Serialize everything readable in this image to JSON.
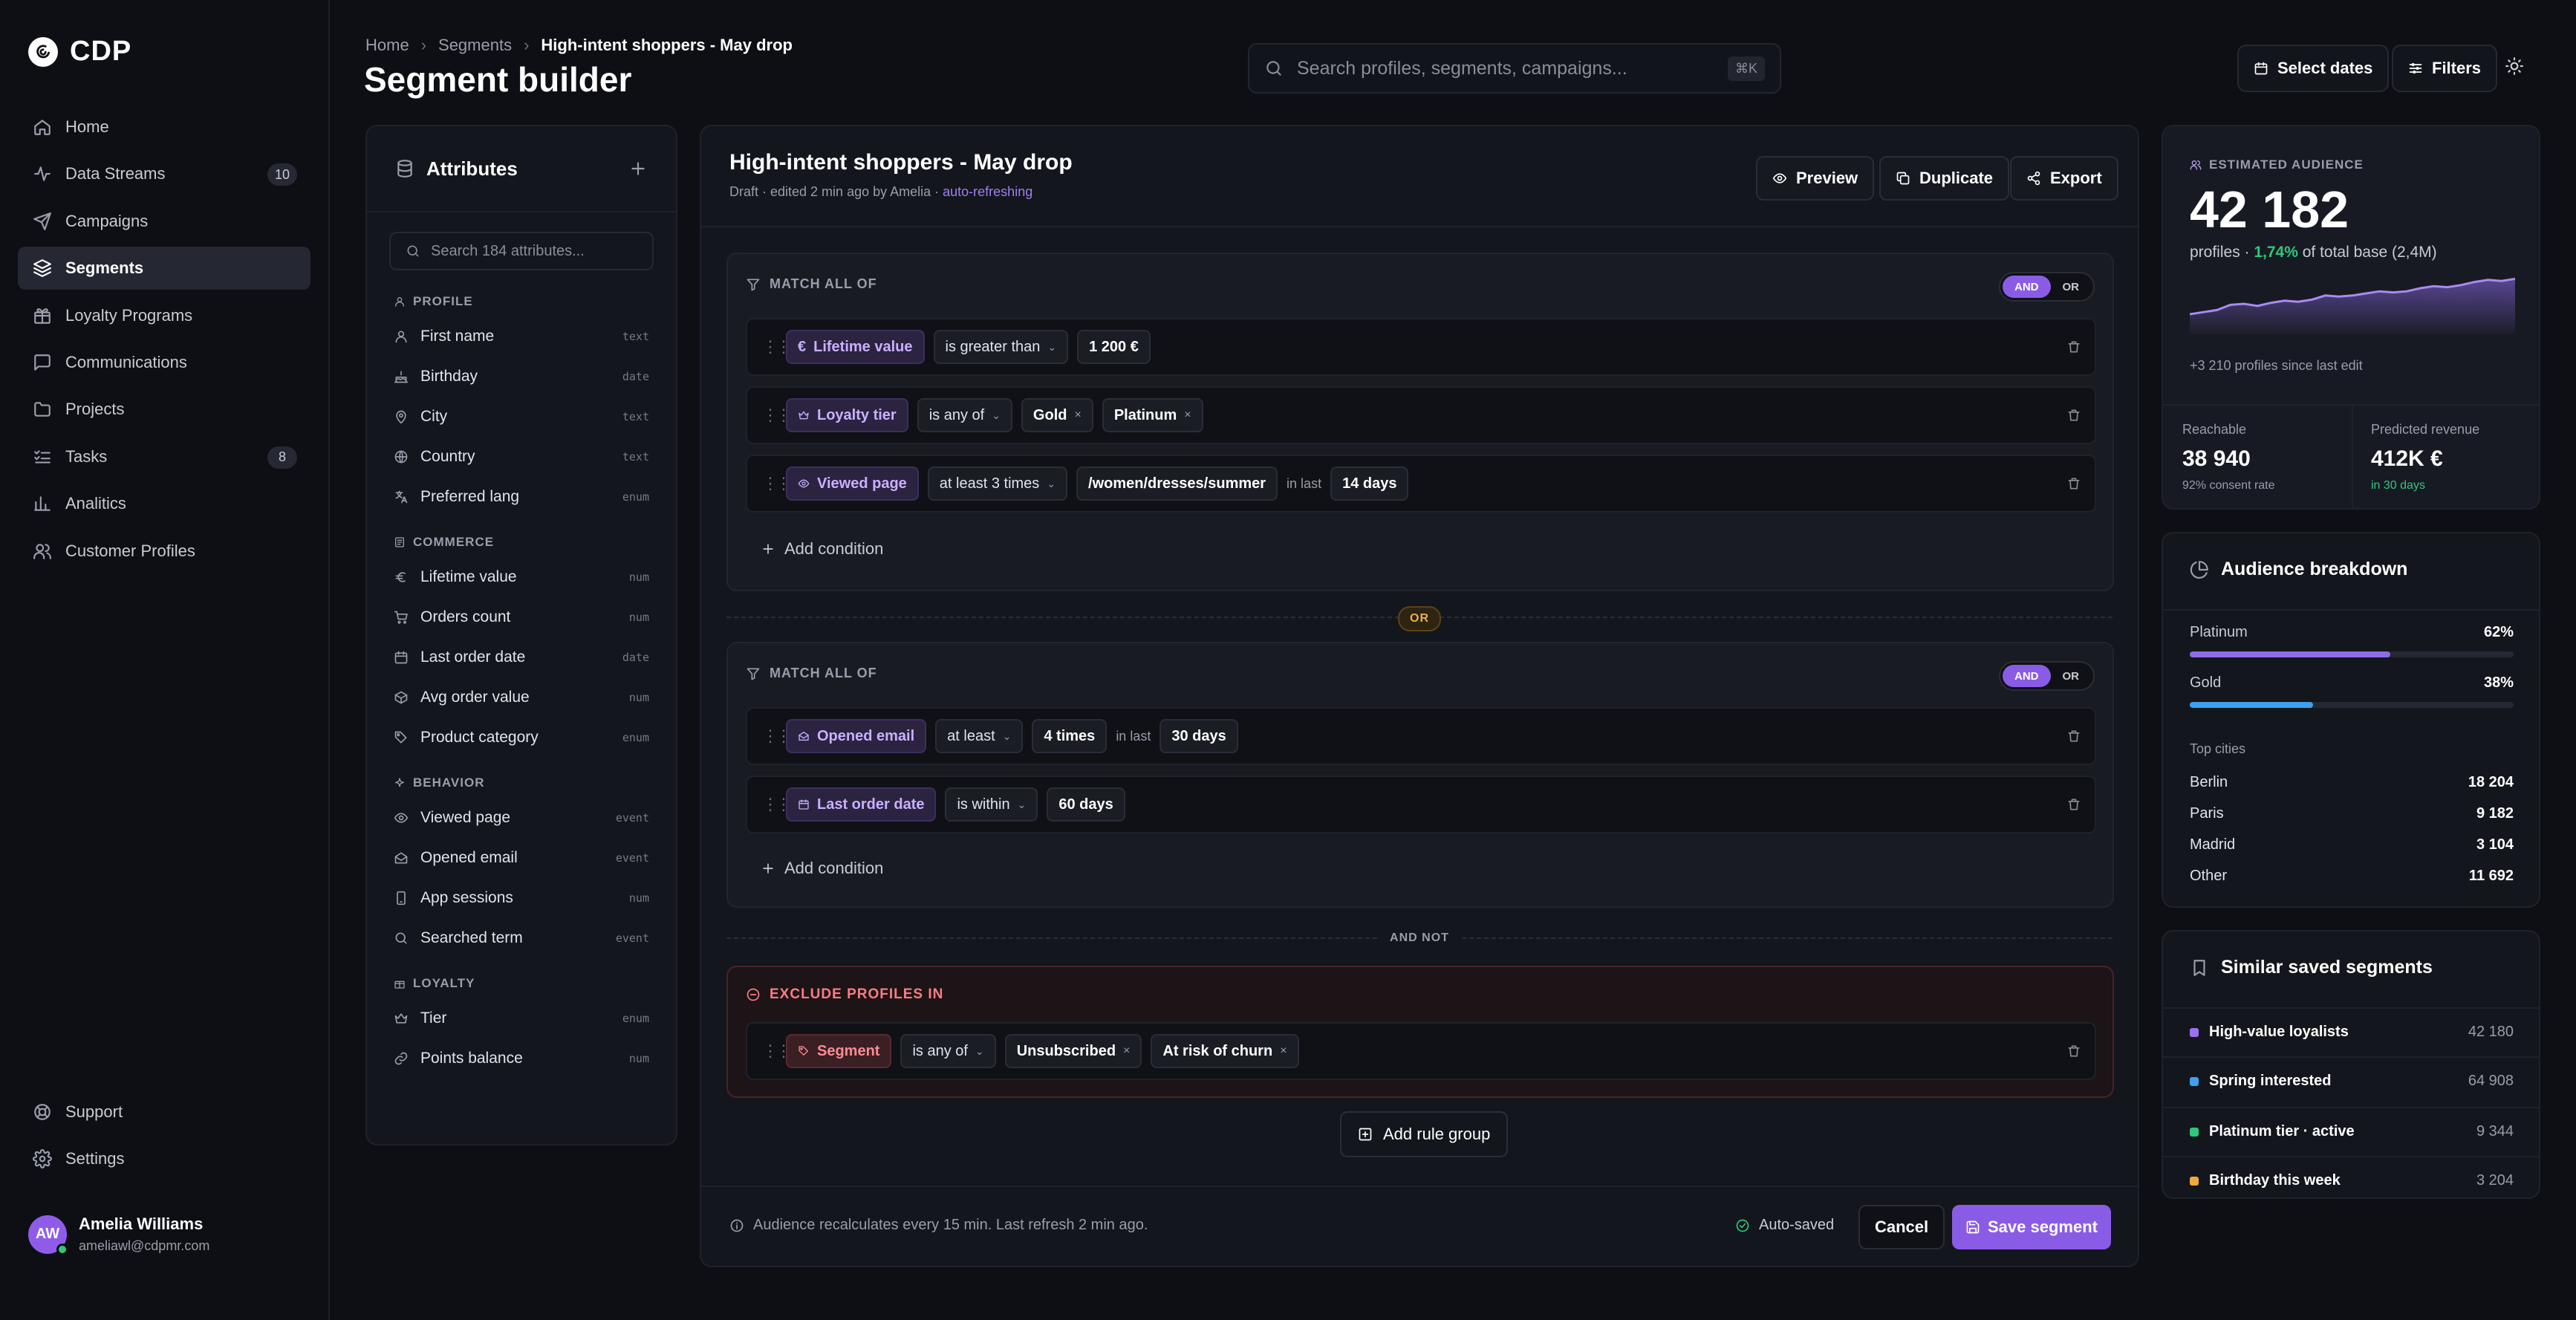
{
  "sidebar": {
    "brand": "CDP",
    "items": [
      {
        "label": "Home",
        "icon": "home-icon"
      },
      {
        "label": "Data Streams",
        "icon": "activity-icon",
        "badge": "10"
      },
      {
        "label": "Campaigns",
        "icon": "send-icon"
      },
      {
        "label": "Segments",
        "icon": "layers-icon",
        "active": true
      },
      {
        "label": "Loyalty Programs",
        "icon": "gift-icon"
      },
      {
        "label": "Communications",
        "icon": "message-icon"
      },
      {
        "label": "Projects",
        "icon": "folder-icon"
      },
      {
        "label": "Tasks",
        "icon": "list-checks-icon",
        "badge": "8"
      },
      {
        "label": "Analitics",
        "icon": "bar-chart-icon"
      },
      {
        "label": "Customer Profiles",
        "icon": "users-icon"
      }
    ],
    "bottom": [
      {
        "label": "Support",
        "icon": "lifebuoy-icon"
      },
      {
        "label": "Settings",
        "icon": "gear-icon"
      }
    ],
    "user": {
      "initials": "AW",
      "name": "Amelia Williams",
      "email": "ameliawl@cdpmr.com"
    }
  },
  "header": {
    "breadcrumb": [
      "Home",
      "Segments",
      "High-intent shoppers - May drop"
    ],
    "title": "Segment builder",
    "search_placeholder": "Search profiles, segments, campaigns...",
    "search_shortcut": "⌘K",
    "select_dates": "Select dates",
    "filters": "Filters"
  },
  "attributes": {
    "title": "Attributes",
    "search_placeholder": "Search 184 attributes...",
    "sections": [
      {
        "label": "PROFILE",
        "items": [
          {
            "name": "First name",
            "type": "text"
          },
          {
            "name": "Birthday",
            "type": "date"
          },
          {
            "name": "City",
            "type": "text"
          },
          {
            "name": "Country",
            "type": "text"
          },
          {
            "name": "Preferred lang",
            "type": "enum"
          }
        ]
      },
      {
        "label": "COMMERCE",
        "items": [
          {
            "name": "Lifetime value",
            "type": "num"
          },
          {
            "name": "Orders count",
            "type": "num"
          },
          {
            "name": "Last order date",
            "type": "date"
          },
          {
            "name": "Avg order value",
            "type": "num"
          },
          {
            "name": "Product category",
            "type": "enum"
          }
        ]
      },
      {
        "label": "BEHAVIOR",
        "items": [
          {
            "name": "Viewed page",
            "type": "event"
          },
          {
            "name": "Opened email",
            "type": "event"
          },
          {
            "name": "App sessions",
            "type": "num"
          },
          {
            "name": "Searched term",
            "type": "event"
          }
        ]
      },
      {
        "label": "LOYALTY",
        "items": [
          {
            "name": "Tier",
            "type": "enum"
          },
          {
            "name": "Points balance",
            "type": "num"
          }
        ]
      }
    ]
  },
  "builder": {
    "segment_name": "High-intent shoppers - May drop",
    "status_prefix": "Draft · edited 2 min ago by Amelia · ",
    "status_live": "auto-refreshing",
    "preview": "Preview",
    "duplicate": "Duplicate",
    "export": "Export",
    "match_all": "MATCH ALL OF",
    "and": "AND",
    "or": "OR",
    "or_pill": "OR",
    "and_not_pill": "AND NOT",
    "add_condition": "Add condition",
    "in_last": "in last",
    "group1": {
      "c1": {
        "attr": "Lifetime value",
        "op": "is greater than",
        "value": "1 200 €"
      },
      "c2": {
        "attr": "Loyalty tier",
        "op": "is any of",
        "values": [
          "Gold",
          "Platinum"
        ]
      },
      "c3": {
        "attr": "Viewed page",
        "op": "at least 3 times",
        "value": "/women/dresses/summer",
        "window": "14 days"
      }
    },
    "group2": {
      "c1": {
        "attr": "Opened email",
        "op": "at least",
        "value": "4 times",
        "window": "30 days"
      },
      "c2": {
        "attr": "Last order date",
        "op": "is within",
        "value": "60 days"
      }
    },
    "exclude": {
      "label": "EXCLUDE PROFILES IN",
      "attr": "Segment",
      "op": "is any of",
      "values": [
        "Unsubscribed",
        "At risk of churn"
      ]
    },
    "add_rule_group": "Add rule group",
    "footer_info": "Audience recalculates every 15 min. Last refresh 2 min ago.",
    "autosaved": "Auto-saved",
    "cancel": "Cancel",
    "save": "Save segment"
  },
  "estimate": {
    "label": "ESTIMATED AUDIENCE",
    "value": "42 182",
    "sub_prefix": "profiles · ",
    "pct": "1,74%",
    "sub_suffix": " of total base (2,4M)",
    "since": "+3 210 profiles since last edit",
    "reachable_label": "Reachable",
    "reachable_value": "38 940",
    "reachable_sub": "92% consent rate",
    "revenue_label": "Predicted revenue",
    "revenue_value": "412K €",
    "revenue_sub": "in 30 days",
    "sparkline": [
      0.3,
      0.34,
      0.38,
      0.48,
      0.5,
      0.46,
      0.52,
      0.56,
      0.54,
      0.58,
      0.66,
      0.64,
      0.66,
      0.7,
      0.74,
      0.72,
      0.74,
      0.8,
      0.84,
      0.82,
      0.86,
      0.92,
      0.96,
      0.94,
      0.98
    ]
  },
  "breakdown": {
    "title": "Audience breakdown",
    "tiers": [
      {
        "name": "Platinum",
        "pct": "62%",
        "fraction": 0.62,
        "color": "#8f6bea"
      },
      {
        "name": "Gold",
        "pct": "38%",
        "fraction": 0.38,
        "color": "#3ea0ee"
      }
    ],
    "cities_label": "Top cities",
    "cities": [
      {
        "name": "Berlin",
        "value": "18 204"
      },
      {
        "name": "Paris",
        "value": "9 182"
      },
      {
        "name": "Madrid",
        "value": "3 104"
      },
      {
        "name": "Other",
        "value": "11 692"
      }
    ]
  },
  "similar": {
    "title": "Similar saved segments",
    "items": [
      {
        "name": "High-value loyalists",
        "count": "42 180",
        "color": "#9a72f0"
      },
      {
        "name": "Spring interested",
        "count": "64 908",
        "color": "#3ea0ee"
      },
      {
        "name": "Platinum tier · active",
        "count": "9 344",
        "color": "#30c77c"
      },
      {
        "name": "Birthday this week",
        "count": "3 204",
        "color": "#f0a93a"
      }
    ]
  }
}
